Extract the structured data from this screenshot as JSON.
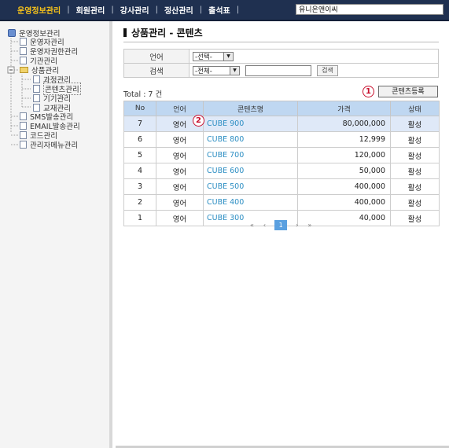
{
  "topnav": {
    "items": [
      {
        "label": "운영정보관리",
        "active": true
      },
      {
        "label": "회원관리",
        "active": false
      },
      {
        "label": "강사관리",
        "active": false
      },
      {
        "label": "정산관리",
        "active": false
      },
      {
        "label": "출석표",
        "active": false
      }
    ],
    "company": "유니온앤이씨"
  },
  "sidebar": {
    "root": "운영정보관리",
    "items": [
      {
        "label": "운영자관리",
        "icon": "document-icon"
      },
      {
        "label": "운영자권한관리",
        "icon": "document-icon"
      },
      {
        "label": "기관관리",
        "icon": "document-icon"
      },
      {
        "label": "상품관리",
        "icon": "folder-open-icon"
      },
      {
        "label": "과정관리",
        "icon": "document-icon"
      },
      {
        "label": "콘텐츠관리",
        "icon": "document-icon"
      },
      {
        "label": "기기관리",
        "icon": "document-icon"
      },
      {
        "label": "교재관리",
        "icon": "document-icon"
      },
      {
        "label": "SMS발송관리",
        "icon": "document-icon"
      },
      {
        "label": "EMAIL발송관리",
        "icon": "document-icon"
      },
      {
        "label": "코드관리",
        "icon": "document-icon"
      },
      {
        "label": "관리자메뉴관리",
        "icon": "document-icon"
      }
    ]
  },
  "main": {
    "title": "상품관리 - 콘텐츠",
    "filters": {
      "language_label": "언어",
      "language_value": "-선택-",
      "search_label": "검색",
      "search_field_value": "-전체-",
      "search_button": "검색"
    },
    "total": "Total : 7 건",
    "register_button": "콘텐츠등록",
    "markers": {
      "one": "1",
      "two": "2"
    },
    "table": {
      "headers": [
        "No",
        "언어",
        "콘텐츠명",
        "가격",
        "상태"
      ],
      "rows": [
        {
          "no": "7",
          "lang": "영어",
          "name": "CUBE 900",
          "price": "80,000,000",
          "status": "활성"
        },
        {
          "no": "6",
          "lang": "영어",
          "name": "CUBE 800",
          "price": "12,999",
          "status": "활성"
        },
        {
          "no": "5",
          "lang": "영어",
          "name": "CUBE 700",
          "price": "120,000",
          "status": "활성"
        },
        {
          "no": "4",
          "lang": "영어",
          "name": "CUBE 600",
          "price": "50,000",
          "status": "활성"
        },
        {
          "no": "3",
          "lang": "영어",
          "name": "CUBE 500",
          "price": "400,000",
          "status": "활성"
        },
        {
          "no": "2",
          "lang": "영어",
          "name": "CUBE 400",
          "price": "400,000",
          "status": "활성"
        },
        {
          "no": "1",
          "lang": "영어",
          "name": "CUBE 300",
          "price": "40,000",
          "status": "활성"
        }
      ]
    },
    "pager": {
      "first": "«",
      "prev": "‹",
      "current": "1",
      "next": "›",
      "last": "»"
    }
  },
  "colors": {
    "nav_bg": "#1f3050",
    "nav_active": "#f6c21b",
    "header_row": "#bfd7f1",
    "link": "#2c8ec3",
    "marker": "#c8102e"
  }
}
